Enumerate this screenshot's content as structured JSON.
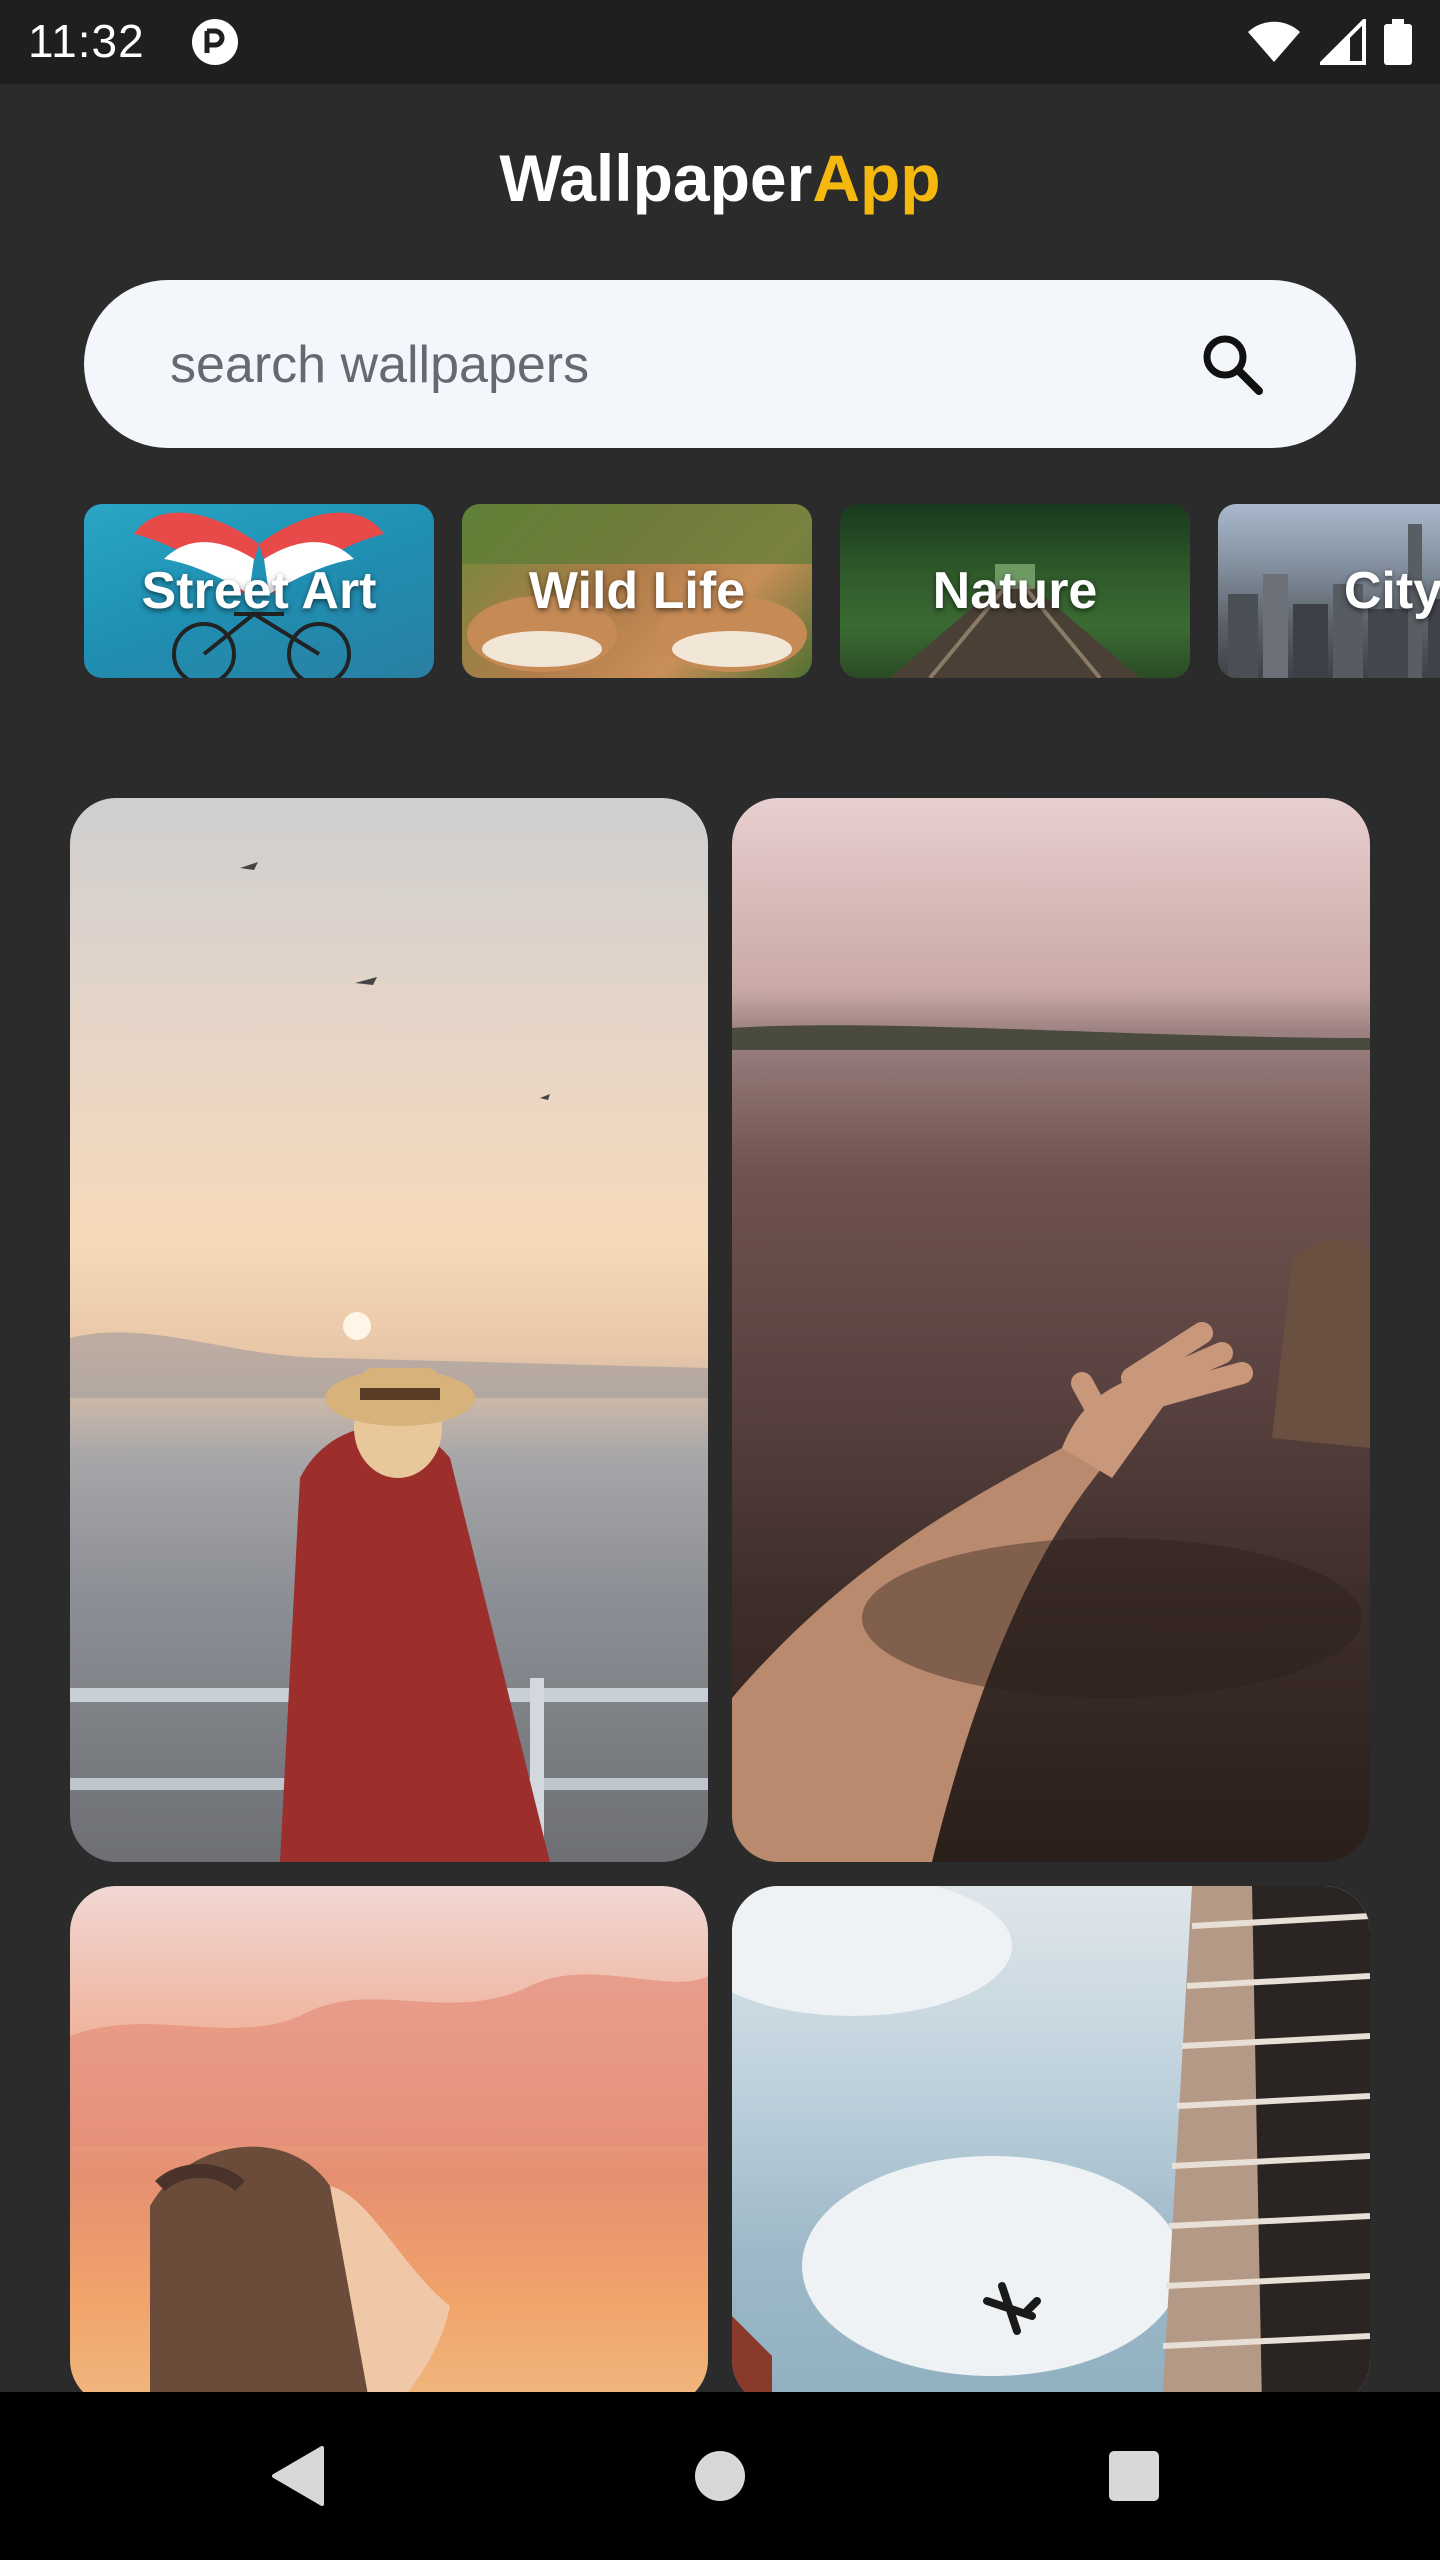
{
  "status_bar": {
    "time": "11:32"
  },
  "header": {
    "title_main": "Wallpaper",
    "title_accent": "App",
    "accent_color": "#f5b80f"
  },
  "search": {
    "placeholder": "search wallpapers",
    "value": ""
  },
  "categories": [
    {
      "label": "Street Art"
    },
    {
      "label": "Wild Life"
    },
    {
      "label": "Nature"
    },
    {
      "label": "City"
    }
  ],
  "wallpapers": [
    {
      "subject": "woman in hat at ship railing at sunset"
    },
    {
      "subject": "hand reaching into lake water"
    },
    {
      "subject": "woman looking at pink clouds"
    },
    {
      "subject": "airplane by tall building"
    }
  ],
  "nav": {
    "back_icon": "back-triangle-icon",
    "home_icon": "home-circle-icon",
    "recents_icon": "recents-square-icon"
  }
}
